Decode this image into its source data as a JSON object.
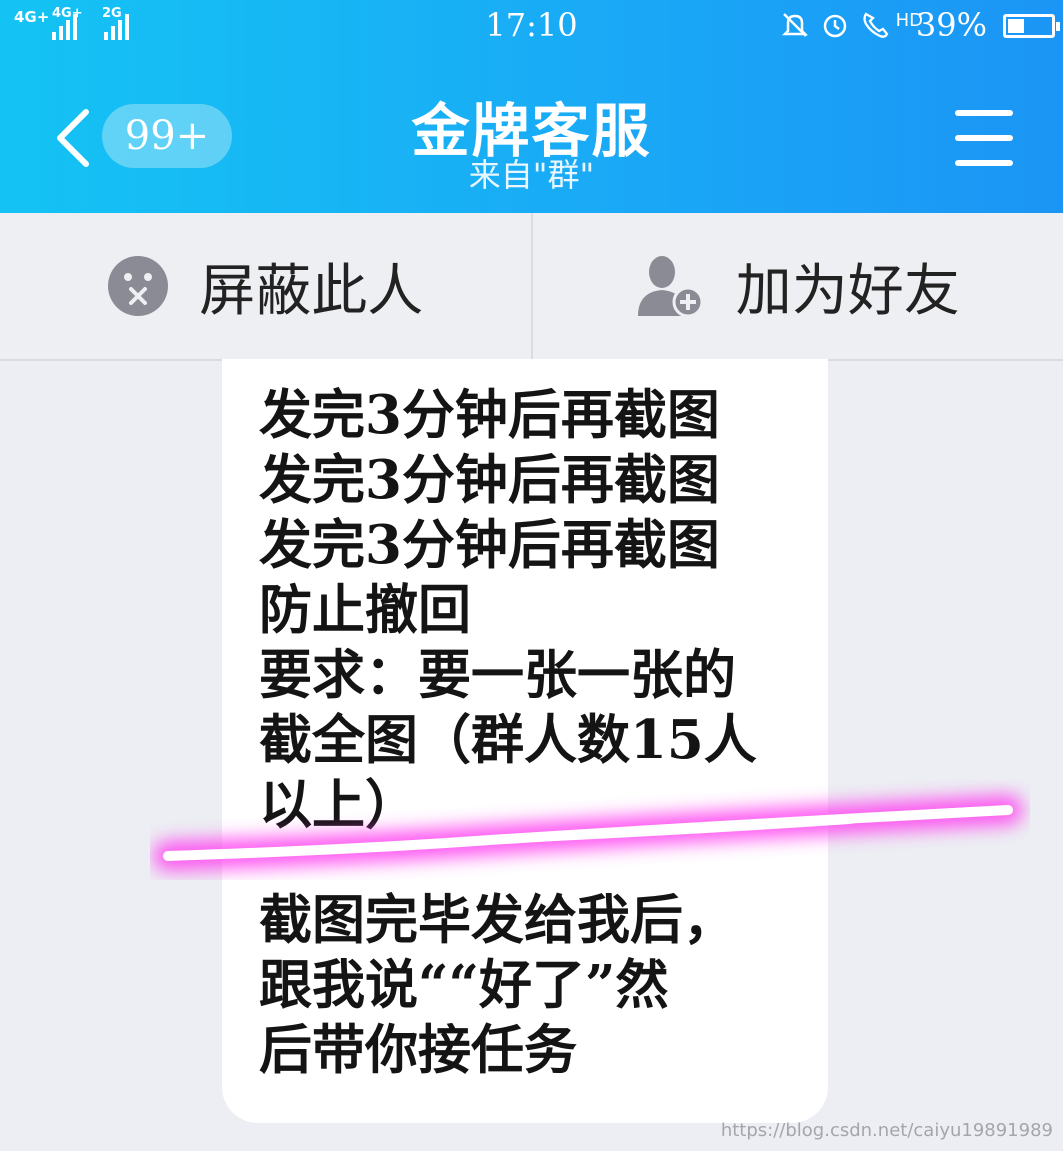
{
  "status_bar": {
    "signal_1": "4G+",
    "signal_2": "4G+",
    "signal_3": "2G",
    "time": "17:10",
    "hd_label": "HD",
    "battery_percent": "39%",
    "battery_level": 0.39,
    "icons": [
      "bell-muted-icon",
      "alarm-icon",
      "volte-call-icon"
    ]
  },
  "header": {
    "back_icon": "chevron-left-icon",
    "unread_count": "99+",
    "title": "金牌客服",
    "subtitle": "来自\"群\"",
    "menu_icon": "hamburger-menu-icon",
    "background_color": "#1aa8f6"
  },
  "actions": {
    "block": {
      "icon": "block-face-icon",
      "label": "屏蔽此人"
    },
    "add_friend": {
      "icon": "add-friend-icon",
      "label": "加为好友"
    }
  },
  "message": {
    "lines": [
      "发完3分钟后再截图",
      "发完3分钟后再截图",
      "发完3分钟后再截图",
      "防止撤回",
      "要求：要一张一张的",
      "截全图（群人数15人",
      "以上）",
      "截图完毕发给我后，",
      "跟我说““好了”然",
      "后带你接任务"
    ],
    "highlight_color": "#ff3cf0"
  },
  "watermark": "https://blog.csdn.net/caiyu19891989"
}
